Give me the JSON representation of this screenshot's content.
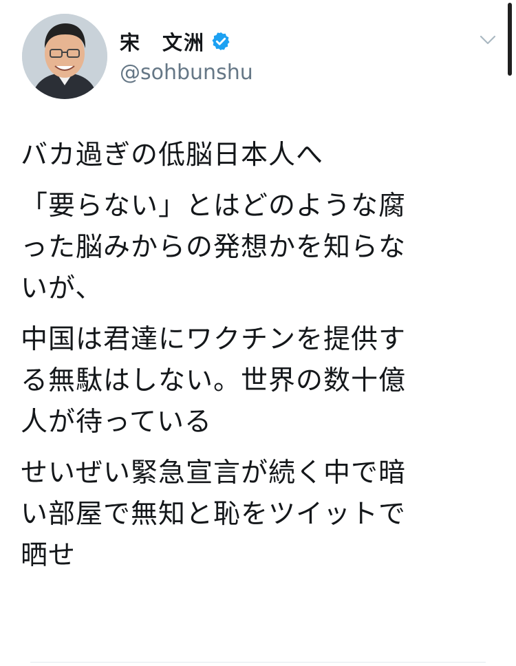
{
  "user": {
    "display_name": "宋　文洲",
    "handle": "@sohbunshu",
    "verified_icon": "verified-badge-icon"
  },
  "tweet": {
    "paragraphs": [
      "バカ過ぎの低脳日本人へ",
      "「要らない」とはどのような腐\nった脳みからの発想かを知らな\nいが、",
      "中国は君達にワクチンを提供す\nる無駄はしない。世界の数十億\n人が待っている",
      "せいぜい緊急宣言が続く中で暗\nい部屋で無知と恥をツイットで\n晒せ"
    ]
  },
  "colors": {
    "text": "#14171a",
    "secondary": "#657786",
    "verified": "#1da1f2",
    "divider": "#e1e8ed"
  },
  "icons": {
    "menu": "chevron-down-icon",
    "avatar": "profile-photo"
  }
}
